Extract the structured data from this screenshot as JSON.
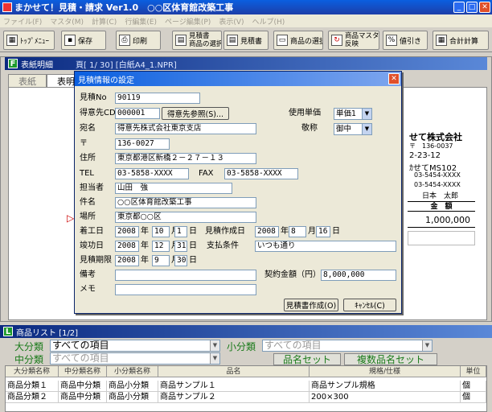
{
  "window": {
    "title": "まかせて！見積・請求 Ver1.0　○○区体育館改築工事"
  },
  "menu": [
    "ファイル(F)",
    "マスタ(M)",
    "計算(C)",
    "行編集(E)",
    "ページ編集(P)",
    "表示(V)",
    "ヘルプ(H)"
  ],
  "toolbar": {
    "top_menu": "ﾄｯﾌﾟﾒﾆｭｰ",
    "save": "保存",
    "print": "印刷",
    "estimate_select_line1": "見積書",
    "estimate_select_line2": "商品の選択",
    "estimate": "見積書",
    "product_select": "商品の選択",
    "master_reflect_line1": "商品マスタの",
    "master_reflect_line2": "反映",
    "discount": "値引き",
    "total_calc": "合計計算"
  },
  "main": {
    "section_badge": "F",
    "section_title": "表紙明細",
    "page_info": "頁[ 1/ 30]  [白紙A4_1.NPR]",
    "tabs": [
      "表紙",
      "表明"
    ],
    "doc": {
      "company": "せて株式会社",
      "postal": "〒　136-0037",
      "address": "2-23-12",
      "building": "ｶせてMS102",
      "tel": "03-5454-XXXX",
      "fax": "03-5454-XXXX",
      "person": "日本　太郎",
      "amount_header": "金　額",
      "amount": "1,000,000"
    }
  },
  "dialog": {
    "title": "見積情報の設定",
    "estimate_no_label": "見積No",
    "estimate_no": "90119",
    "client_cd_label": "得意先CD",
    "client_cd": "000001",
    "client_ref_button": "得意先参照(S)...",
    "unit_price_label": "使用単価",
    "unit_price": "単価1",
    "recipient_label": "宛名",
    "recipient": "得意先株式会社東京支店",
    "honorific_label": "敬称",
    "honorific": "御中",
    "postal_label": "〒",
    "postal": "136-0027",
    "address_label": "住所",
    "address": "東京都港区新橋２－２７－１３",
    "tel_label": "TEL",
    "tel": "03-5858-XXXX",
    "fax_label": "FAX",
    "fax": "03-5858-XXXX",
    "person_label": "担当者",
    "person": "山田　強",
    "subject_label": "件名",
    "subject": "○○区体育館改築工事",
    "place_label": "場所",
    "place": "東京都○○区",
    "start_label": "着工日",
    "start_year": "2008",
    "start_month": "10",
    "start_day": "1",
    "created_label": "見積作成日",
    "created_year": "2008",
    "created_month": "8",
    "created_day": "16",
    "finish_label": "竣功日",
    "finish_year": "2008",
    "finish_month": "12",
    "finish_day": "31",
    "payment_label": "支払条件",
    "payment": "いつも通り",
    "valid_label": "見積期限",
    "valid_year": "2008",
    "valid_month": "9",
    "valid_day": "30",
    "note_label": "備考",
    "note": "",
    "contract_label": "契約金額（円）",
    "contract": "8,000,000",
    "memo_label": "メモ",
    "memo": "",
    "year_unit": "年",
    "month_unit": "月",
    "day_unit": "日",
    "create_button": "見積書作成(O)",
    "cancel_button": "ｷｬﾝｾﾙ(C)"
  },
  "list": {
    "badge": "L",
    "title": "商品リスト [1/2]",
    "large_cat_label": "大分類",
    "large_cat_value": "すべての項目",
    "small_cat_label": "小分類",
    "small_cat_value": "すべての項目",
    "mid_cat_label": "中分類",
    "mid_cat_value": "すべての項目",
    "name_set_button": "品名セット",
    "multi_name_set_button": "複数品名セット",
    "columns": [
      "大分類名称",
      "中分類名称",
      "小分類名称",
      "品名",
      "規格/仕様",
      "単位"
    ],
    "rows": [
      [
        "商品分類１",
        "商品中分類",
        "商品小分類",
        "商品サンプル１",
        "商品サンプル規格",
        "個"
      ],
      [
        "商品分類２",
        "商品中分類",
        "商品小分類",
        "商品サンプル２",
        "200×300",
        "個"
      ]
    ]
  }
}
